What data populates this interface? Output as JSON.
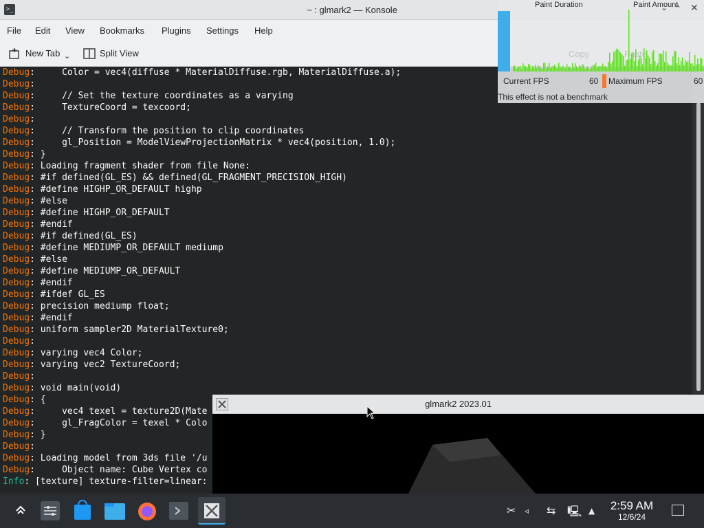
{
  "konsole": {
    "title": "~ : glmark2 — Konsole",
    "menu": [
      "File",
      "Edit",
      "View",
      "Bookmarks",
      "Plugins",
      "Settings",
      "Help"
    ],
    "toolbar": {
      "new_tab": "New Tab",
      "split_view": "Split View"
    },
    "lines": [
      {
        "tag": "Debug",
        "sep": ":",
        "text": "     Color = vec4(diffuse * MaterialDiffuse.rgb, MaterialDiffuse.a);"
      },
      {
        "tag": "Debug",
        "sep": ":",
        "text": ""
      },
      {
        "tag": "Debug",
        "sep": ":",
        "text": "     // Set the texture coordinates as a varying"
      },
      {
        "tag": "Debug",
        "sep": ":",
        "text": "     TextureCoord = texcoord;"
      },
      {
        "tag": "Debug",
        "sep": ":",
        "text": ""
      },
      {
        "tag": "Debug",
        "sep": ":",
        "text": "     // Transform the position to clip coordinates"
      },
      {
        "tag": "Debug",
        "sep": ":",
        "text": "     gl_Position = ModelViewProjectionMatrix * vec4(position, 1.0);"
      },
      {
        "tag": "Debug",
        "sep": ":",
        "text": " }"
      },
      {
        "tag": "Debug",
        "sep": ":",
        "text": " Loading fragment shader from file None:"
      },
      {
        "tag": "Debug",
        "sep": ":",
        "text": " #if defined(GL_ES) && defined(GL_FRAGMENT_PRECISION_HIGH)"
      },
      {
        "tag": "Debug",
        "sep": ":",
        "text": " #define HIGHP_OR_DEFAULT highp"
      },
      {
        "tag": "Debug",
        "sep": ":",
        "text": " #else"
      },
      {
        "tag": "Debug",
        "sep": ":",
        "text": " #define HIGHP_OR_DEFAULT"
      },
      {
        "tag": "Debug",
        "sep": ":",
        "text": " #endif"
      },
      {
        "tag": "Debug",
        "sep": ":",
        "text": " #if defined(GL_ES)"
      },
      {
        "tag": "Debug",
        "sep": ":",
        "text": " #define MEDIUMP_OR_DEFAULT mediump"
      },
      {
        "tag": "Debug",
        "sep": ":",
        "text": " #else"
      },
      {
        "tag": "Debug",
        "sep": ":",
        "text": " #define MEDIUMP_OR_DEFAULT"
      },
      {
        "tag": "Debug",
        "sep": ":",
        "text": " #endif"
      },
      {
        "tag": "Debug",
        "sep": ":",
        "text": " #ifdef GL_ES"
      },
      {
        "tag": "Debug",
        "sep": ":",
        "text": " precision mediump float;"
      },
      {
        "tag": "Debug",
        "sep": ":",
        "text": " #endif"
      },
      {
        "tag": "Debug",
        "sep": ":",
        "text": " uniform sampler2D MaterialTexture0;"
      },
      {
        "tag": "Debug",
        "sep": ":",
        "text": ""
      },
      {
        "tag": "Debug",
        "sep": ":",
        "text": " varying vec4 Color;"
      },
      {
        "tag": "Debug",
        "sep": ":",
        "text": " varying vec2 TextureCoord;"
      },
      {
        "tag": "Debug",
        "sep": ":",
        "text": ""
      },
      {
        "tag": "Debug",
        "sep": ":",
        "text": " void main(void)"
      },
      {
        "tag": "Debug",
        "sep": ":",
        "text": " {"
      },
      {
        "tag": "Debug",
        "sep": ":",
        "text": "     vec4 texel = texture2D(Mate"
      },
      {
        "tag": "Debug",
        "sep": ":",
        "text": "     gl_FragColor = texel * Colo"
      },
      {
        "tag": "Debug",
        "sep": ":",
        "text": " }"
      },
      {
        "tag": "Debug",
        "sep": ":",
        "text": ""
      },
      {
        "tag": "Debug",
        "sep": ":",
        "text": " Loading model from 3ds file '/u"
      },
      {
        "tag": "Debug",
        "sep": ":",
        "text": "     Object name: Cube Vertex co"
      },
      {
        "tag": "Info",
        "sep": ":",
        "text": " [texture] texture-filter=linear:"
      }
    ]
  },
  "fps_overlay": {
    "paint_duration": "Paint Duration",
    "paint_amount": "Paint Amount",
    "current_fps_label": "Current FPS",
    "current_fps": "60",
    "maximum_fps_label": "Maximum FPS",
    "maximum_fps": "60",
    "note": "This effect is not a benchmark",
    "ghost_copy": "Copy",
    "ghost_paste": "Paste"
  },
  "glmark": {
    "title": "glmark2 2023.01"
  },
  "taskbar": {
    "apps": [
      "application-launcher-icon",
      "system-settings-icon",
      "discover-icon",
      "dolphin-icon",
      "firefox-icon",
      "konsole-icon",
      "glmark2-icon"
    ],
    "clock_time": "2:59 AM",
    "clock_date": "12/6/24"
  },
  "colors": {
    "debug_tag": "#f67400",
    "info_tag": "#1abc9c",
    "accent": "#3daee9"
  }
}
